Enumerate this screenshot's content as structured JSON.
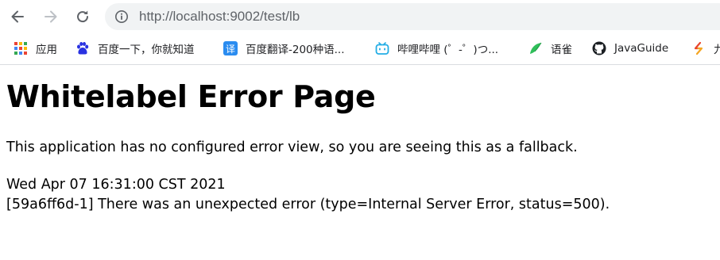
{
  "browser": {
    "url": "http://localhost:9002/test/lb"
  },
  "bookmarks": [
    {
      "label": "应用",
      "icon": "apps-grid-icon"
    },
    {
      "label": "百度一下，你就知道",
      "icon": "baidu-paw-icon"
    },
    {
      "label": "百度翻译-200种语...",
      "icon": "baidu-translate-icon",
      "icon_text": "译"
    },
    {
      "label": "哔哩哔哩 (゜-゜)つ...",
      "icon": "bilibili-tv-icon"
    },
    {
      "label": "语雀",
      "icon": "yuque-bird-icon"
    },
    {
      "label": "JavaGuide",
      "icon": "github-icon"
    },
    {
      "label": "九",
      "icon": "bookmark-icon"
    }
  ],
  "page": {
    "title": "Whitelabel Error Page",
    "message": "This application has no configured error view, so you are seeing this as a fallback.",
    "timestamp": "Wed Apr 07 16:31:00 CST 2021",
    "error": "[59a6ff6d-1] There was an unexpected error (type=Internal Server Error, status=500)."
  },
  "colors": {
    "omnibox_bg": "#f1f3f4",
    "url_text": "#5f6368",
    "translate_blue": "#2a8cf0",
    "bilibili_blue": "#23ade5",
    "yuque_green": "#2fbf5a"
  }
}
